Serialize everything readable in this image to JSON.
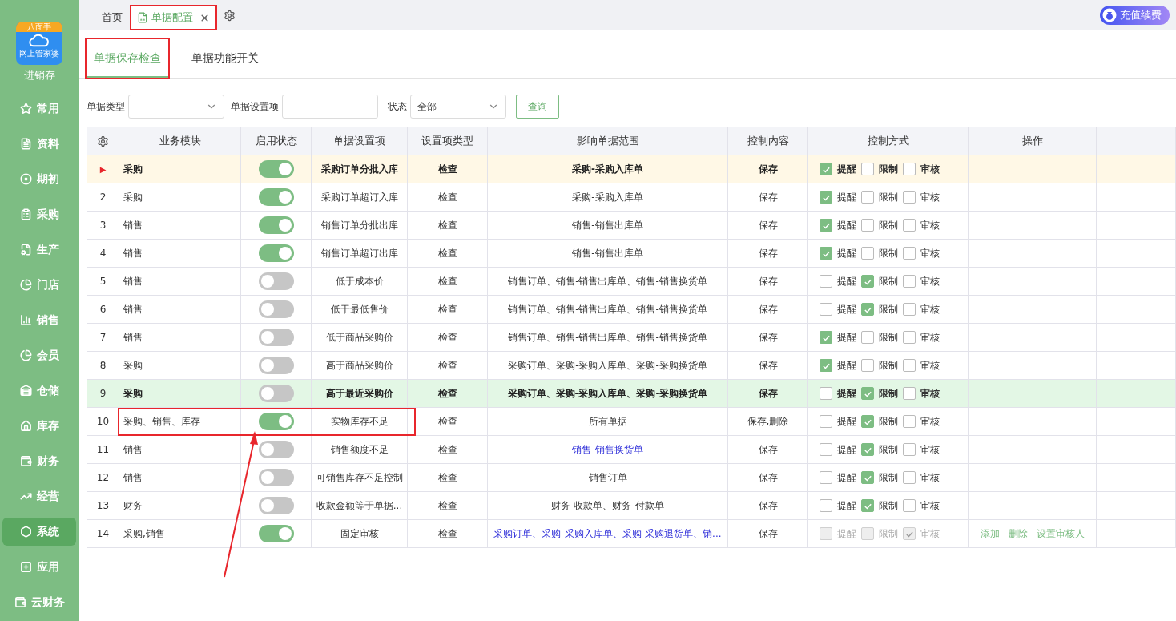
{
  "sidebar": {
    "logo": {
      "top": "八面手",
      "bottom": "网上管家婆"
    },
    "app_name": "进销存",
    "items": [
      {
        "label": "常用",
        "selected": false
      },
      {
        "label": "资料",
        "selected": false
      },
      {
        "label": "期初",
        "selected": false
      },
      {
        "label": "采购",
        "selected": false
      },
      {
        "label": "生产",
        "selected": false
      },
      {
        "label": "门店",
        "selected": false
      },
      {
        "label": "销售",
        "selected": false
      },
      {
        "label": "会员",
        "selected": false
      },
      {
        "label": "仓储",
        "selected": false
      },
      {
        "label": "库存",
        "selected": false
      },
      {
        "label": "财务",
        "selected": false
      },
      {
        "label": "经营",
        "selected": false
      },
      {
        "label": "系统",
        "selected": true
      },
      {
        "label": "应用",
        "selected": false
      },
      {
        "label": "云财务",
        "selected": false
      }
    ]
  },
  "doc_tabs": [
    {
      "label": "首页",
      "selected": false,
      "closable": false,
      "highlighted": false
    },
    {
      "label": "单据配置",
      "selected": true,
      "closable": true,
      "highlighted": true
    }
  ],
  "renew_button": "充值续费",
  "sub_tabs": [
    {
      "label": "单据保存检查",
      "selected": true,
      "highlighted": true
    },
    {
      "label": "单据功能开关",
      "selected": false,
      "highlighted": false
    }
  ],
  "filters": {
    "doc_type_label": "单据类型",
    "setting_label": "单据设置项",
    "status_label": "状态",
    "status_value": "全部",
    "query_button": "查询"
  },
  "table": {
    "columns": [
      "业务模块",
      "启用状态",
      "单据设置项",
      "设置项类型",
      "影响单据范围",
      "控制内容",
      "控制方式",
      "操作"
    ],
    "rows": [
      {
        "index": "▶",
        "selected": true,
        "hovered": false,
        "module": "采购",
        "on": true,
        "setting": "采购订单分批入库",
        "type": "检查",
        "scope": "采购-采购入库单",
        "scope_link": false,
        "content": "保存",
        "controls": [
          {
            "label": "提醒",
            "checked": true,
            "disabled": false
          },
          {
            "label": "限制",
            "checked": false,
            "disabled": false
          },
          {
            "label": "审核",
            "checked": false,
            "disabled": false
          }
        ],
        "actions": [],
        "highlighted": false
      },
      {
        "index": "2",
        "selected": false,
        "hovered": false,
        "module": "采购",
        "on": true,
        "setting": "采购订单超订入库",
        "type": "检查",
        "scope": "采购-采购入库单",
        "scope_link": false,
        "content": "保存",
        "controls": [
          {
            "label": "提醒",
            "checked": true,
            "disabled": false
          },
          {
            "label": "限制",
            "checked": false,
            "disabled": false
          },
          {
            "label": "审核",
            "checked": false,
            "disabled": false
          }
        ],
        "actions": [],
        "highlighted": false
      },
      {
        "index": "3",
        "selected": false,
        "hovered": false,
        "module": "销售",
        "on": true,
        "setting": "销售订单分批出库",
        "type": "检查",
        "scope": "销售-销售出库单",
        "scope_link": false,
        "content": "保存",
        "controls": [
          {
            "label": "提醒",
            "checked": true,
            "disabled": false
          },
          {
            "label": "限制",
            "checked": false,
            "disabled": false
          },
          {
            "label": "审核",
            "checked": false,
            "disabled": false
          }
        ],
        "actions": [],
        "highlighted": false
      },
      {
        "index": "4",
        "selected": false,
        "hovered": false,
        "module": "销售",
        "on": true,
        "setting": "销售订单超订出库",
        "type": "检查",
        "scope": "销售-销售出库单",
        "scope_link": false,
        "content": "保存",
        "controls": [
          {
            "label": "提醒",
            "checked": true,
            "disabled": false
          },
          {
            "label": "限制",
            "checked": false,
            "disabled": false
          },
          {
            "label": "审核",
            "checked": false,
            "disabled": false
          }
        ],
        "actions": [],
        "highlighted": false
      },
      {
        "index": "5",
        "selected": false,
        "hovered": false,
        "module": "销售",
        "on": false,
        "setting": "低于成本价",
        "type": "检查",
        "scope": "销售订单、销售-销售出库单、销售-销售换货单",
        "scope_link": false,
        "content": "保存",
        "controls": [
          {
            "label": "提醒",
            "checked": false,
            "disabled": false
          },
          {
            "label": "限制",
            "checked": true,
            "disabled": false
          },
          {
            "label": "审核",
            "checked": false,
            "disabled": false
          }
        ],
        "actions": [],
        "highlighted": false
      },
      {
        "index": "6",
        "selected": false,
        "hovered": false,
        "module": "销售",
        "on": false,
        "setting": "低于最低售价",
        "type": "检查",
        "scope": "销售订单、销售-销售出库单、销售-销售换货单",
        "scope_link": false,
        "content": "保存",
        "controls": [
          {
            "label": "提醒",
            "checked": false,
            "disabled": false
          },
          {
            "label": "限制",
            "checked": true,
            "disabled": false
          },
          {
            "label": "审核",
            "checked": false,
            "disabled": false
          }
        ],
        "actions": [],
        "highlighted": false
      },
      {
        "index": "7",
        "selected": false,
        "hovered": false,
        "module": "销售",
        "on": false,
        "setting": "低于商品采购价",
        "type": "检查",
        "scope": "销售订单、销售-销售出库单、销售-销售换货单",
        "scope_link": false,
        "content": "保存",
        "controls": [
          {
            "label": "提醒",
            "checked": true,
            "disabled": false
          },
          {
            "label": "限制",
            "checked": false,
            "disabled": false
          },
          {
            "label": "审核",
            "checked": false,
            "disabled": false
          }
        ],
        "actions": [],
        "highlighted": false
      },
      {
        "index": "8",
        "selected": false,
        "hovered": false,
        "module": "采购",
        "on": false,
        "setting": "高于商品采购价",
        "type": "检查",
        "scope": "采购订单、采购-采购入库单、采购-采购换货单",
        "scope_link": false,
        "content": "保存",
        "controls": [
          {
            "label": "提醒",
            "checked": true,
            "disabled": false
          },
          {
            "label": "限制",
            "checked": false,
            "disabled": false
          },
          {
            "label": "审核",
            "checked": false,
            "disabled": false
          }
        ],
        "actions": [],
        "highlighted": false
      },
      {
        "index": "9",
        "selected": false,
        "hovered": true,
        "module": "采购",
        "on": false,
        "setting": "高于最近采购价",
        "type": "检查",
        "scope": "采购订单、采购-采购入库单、采购-采购换货单",
        "scope_link": false,
        "content": "保存",
        "controls": [
          {
            "label": "提醒",
            "checked": false,
            "disabled": false
          },
          {
            "label": "限制",
            "checked": true,
            "disabled": false
          },
          {
            "label": "审核",
            "checked": false,
            "disabled": false
          }
        ],
        "actions": [],
        "highlighted": false
      },
      {
        "index": "10",
        "selected": false,
        "hovered": false,
        "module": "采购、销售、库存",
        "on": true,
        "setting": "实物库存不足",
        "type": "检查",
        "scope": "所有单据",
        "scope_link": false,
        "content": "保存,删除",
        "controls": [
          {
            "label": "提醒",
            "checked": false,
            "disabled": false
          },
          {
            "label": "限制",
            "checked": true,
            "disabled": false
          },
          {
            "label": "审核",
            "checked": false,
            "disabled": false
          }
        ],
        "actions": [],
        "highlighted": true
      },
      {
        "index": "11",
        "selected": false,
        "hovered": false,
        "module": "销售",
        "on": false,
        "setting": "销售额度不足",
        "type": "检查",
        "scope": "销售-销售换货单",
        "scope_link": true,
        "content": "保存",
        "controls": [
          {
            "label": "提醒",
            "checked": false,
            "disabled": false
          },
          {
            "label": "限制",
            "checked": true,
            "disabled": false
          },
          {
            "label": "审核",
            "checked": false,
            "disabled": false
          }
        ],
        "actions": [],
        "highlighted": false
      },
      {
        "index": "12",
        "selected": false,
        "hovered": false,
        "module": "销售",
        "on": false,
        "setting": "可销售库存不足控制",
        "type": "检查",
        "scope": "销售订单",
        "scope_link": false,
        "content": "保存",
        "controls": [
          {
            "label": "提醒",
            "checked": false,
            "disabled": false
          },
          {
            "label": "限制",
            "checked": true,
            "disabled": false
          },
          {
            "label": "审核",
            "checked": false,
            "disabled": false
          }
        ],
        "actions": [],
        "highlighted": false
      },
      {
        "index": "13",
        "selected": false,
        "hovered": false,
        "module": "财务",
        "on": false,
        "setting": "收款金额等于单据...",
        "type": "检查",
        "scope": "财务-收款单、财务-付款单",
        "scope_link": false,
        "content": "保存",
        "controls": [
          {
            "label": "提醒",
            "checked": false,
            "disabled": false
          },
          {
            "label": "限制",
            "checked": true,
            "disabled": false
          },
          {
            "label": "审核",
            "checked": false,
            "disabled": false
          }
        ],
        "actions": [],
        "highlighted": false
      },
      {
        "index": "14",
        "selected": false,
        "hovered": false,
        "module": "采购,销售",
        "on": true,
        "setting": "固定审核",
        "type": "检查",
        "scope": "采购订单、采购-采购入库单、采购-采购退货单、销...",
        "scope_link": true,
        "content": "保存",
        "controls": [
          {
            "label": "提醒",
            "checked": false,
            "disabled": true
          },
          {
            "label": "限制",
            "checked": false,
            "disabled": true
          },
          {
            "label": "审核",
            "checked": true,
            "disabled": true
          }
        ],
        "actions": [
          "添加",
          "删除",
          "设置审核人"
        ],
        "highlighted": false
      }
    ]
  }
}
